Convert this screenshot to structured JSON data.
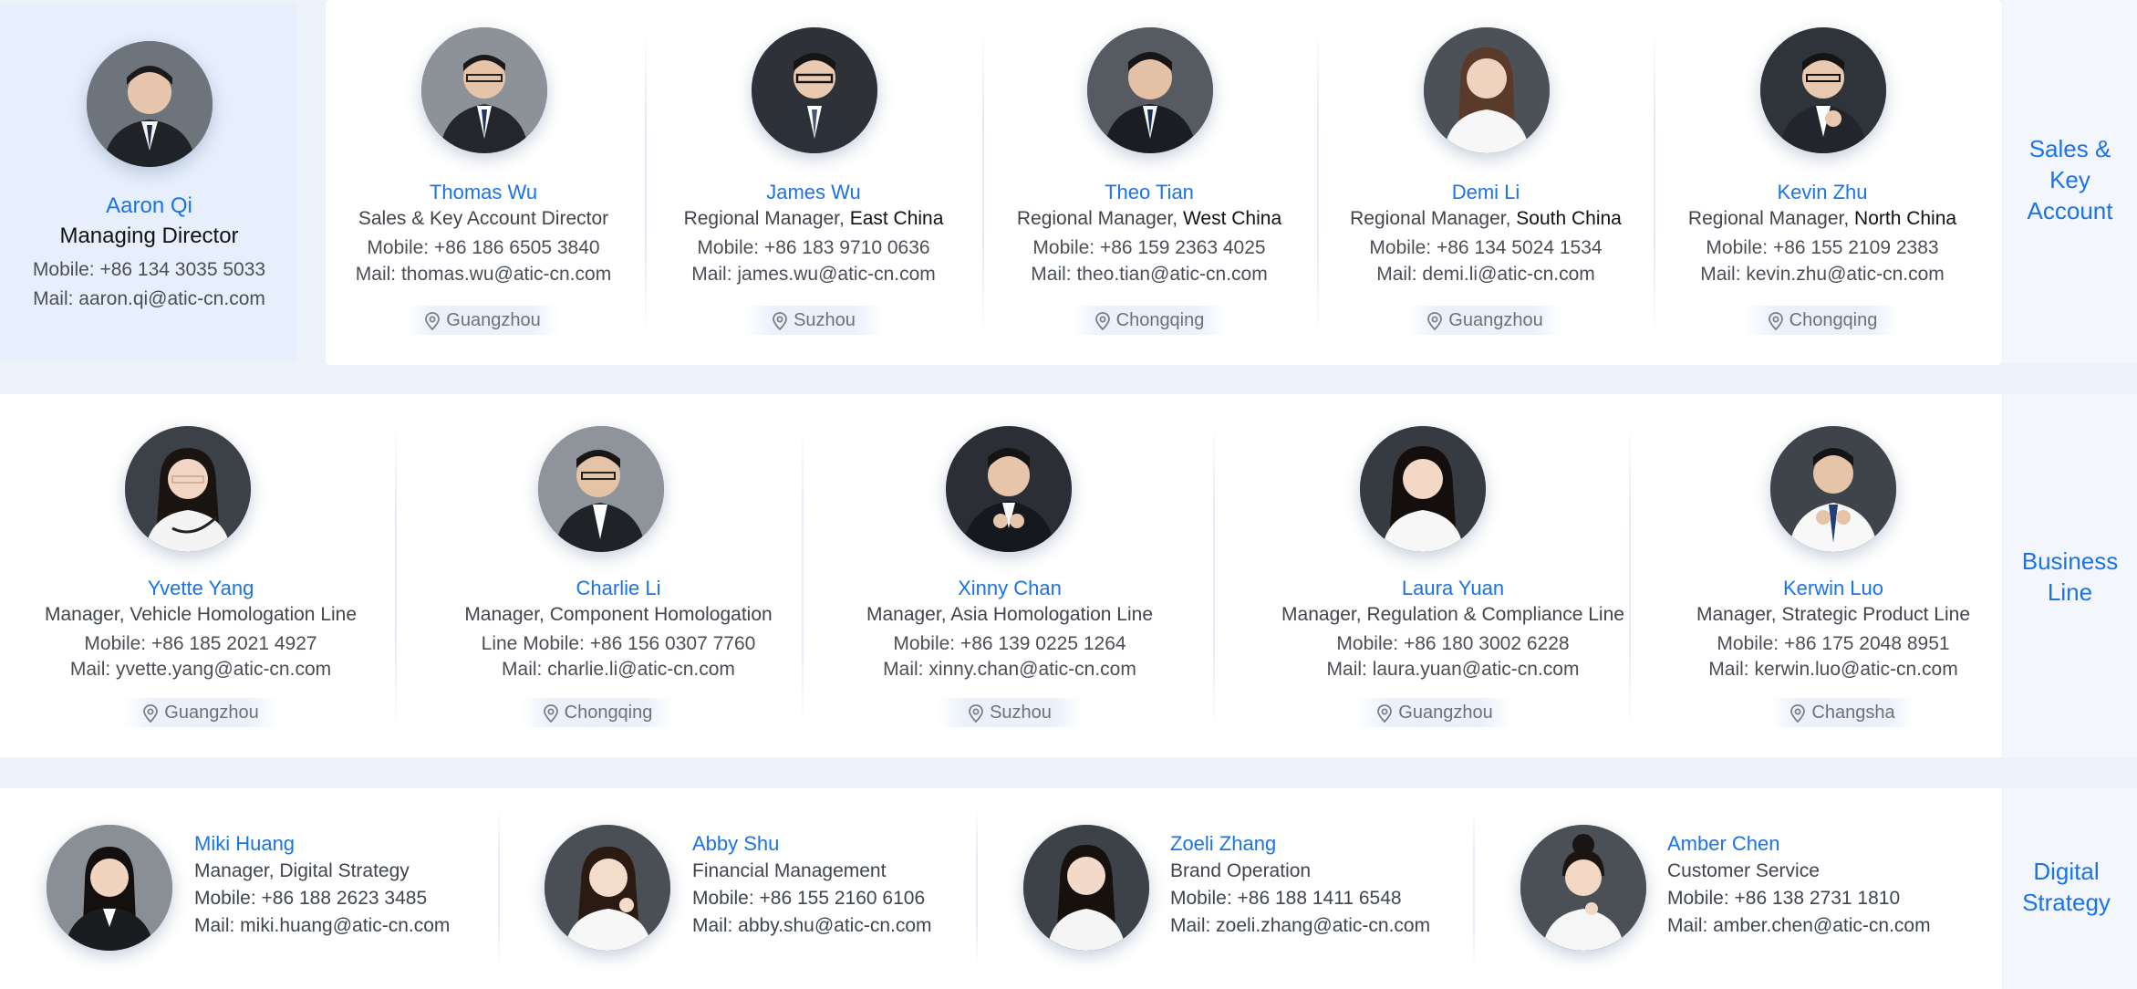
{
  "managing_director": {
    "name": "Aaron Qi",
    "title": "Managing Director",
    "mobile": "Mobile: +86 134 3035 5033",
    "mail": "Mail: aaron.qi@atic-cn.com"
  },
  "sections": {
    "sales": {
      "label_lines": [
        "Sales &",
        "Key",
        "Account"
      ]
    },
    "business": {
      "label_lines": [
        "Business",
        "Line"
      ]
    },
    "digital": {
      "label_lines": [
        "Digital",
        "Strategy"
      ]
    }
  },
  "sales_team": [
    {
      "name": "Thomas Wu",
      "role": "Sales & Key Account Director",
      "role_region": "",
      "mobile": "Mobile: +86 186 6505 3840",
      "mail": "Mail: thomas.wu@atic-cn.com",
      "location": "Guangzhou"
    },
    {
      "name": "James Wu",
      "role": "Regional Manager, ",
      "role_region": "East China",
      "mobile": "Mobile: +86 183 9710 0636",
      "mail": "Mail: james.wu@atic-cn.com",
      "location": "Suzhou"
    },
    {
      "name": "Theo Tian",
      "role": "Regional Manager, ",
      "role_region": "West China",
      "mobile": "Mobile: +86 159 2363 4025",
      "mail": "Mail: theo.tian@atic-cn.com",
      "location": "Chongqing"
    },
    {
      "name": "Demi Li",
      "role": "Regional Manager, ",
      "role_region": "South China",
      "mobile": "Mobile: +86 134 5024 1534",
      "mail": "Mail: demi.li@atic-cn.com",
      "location": "Guangzhou"
    },
    {
      "name": "Kevin Zhu",
      "role": "Regional Manager, ",
      "role_region": "North China",
      "mobile": "Mobile: +86 155 2109 2383",
      "mail": "Mail: kevin.zhu@atic-cn.com",
      "location": "Chongqing"
    }
  ],
  "business_team": [
    {
      "name": "Yvette Yang",
      "role": "Manager, Vehicle Homologation Line",
      "mobile": "Mobile: +86 185 2021 4927",
      "mail": "Mail: yvette.yang@atic-cn.com",
      "location": "Guangzhou"
    },
    {
      "name": "Charlie Li",
      "role": "Manager, Component Homologation",
      "mobile": "Line Mobile: +86 156 0307 7760",
      "mail": "Mail: charlie.li@atic-cn.com",
      "location": "Chongqing"
    },
    {
      "name": "Xinny Chan",
      "role": "Manager, Asia Homologation Line",
      "mobile": "Mobile: +86 139 0225 1264",
      "mail": "Mail: xinny.chan@atic-cn.com",
      "location": "Suzhou"
    },
    {
      "name": "Laura Yuan",
      "role": "Manager, Regulation & Compliance Line",
      "mobile": "Mobile: +86 180 3002 6228",
      "mail": "Mail: laura.yuan@atic-cn.com",
      "location": "Guangzhou"
    },
    {
      "name": "Kerwin Luo",
      "role": "Manager, Strategic Product Line",
      "mobile": "Mobile: +86 175 2048 8951",
      "mail": "Mail: kerwin.luo@atic-cn.com",
      "location": "Changsha"
    }
  ],
  "digital_team": [
    {
      "name": "Miki Huang",
      "role": "Manager, Digital Strategy",
      "mobile": "Mobile: +86 188 2623 3485",
      "mail": "Mail: miki.huang@atic-cn.com"
    },
    {
      "name": "Abby Shu",
      "role": "Financial Management",
      "mobile": "Mobile: +86 155 2160 6106",
      "mail": "Mail: abby.shu@atic-cn.com"
    },
    {
      "name": "Zoeli Zhang",
      "role": "Brand Operation",
      "mobile": "Mobile: +86 188 1411 6548",
      "mail": "Mail: zoeli.zhang@atic-cn.com"
    },
    {
      "name": "Amber Chen",
      "role": "Customer Service",
      "mobile": "Mobile: +86 138 2731 1810",
      "mail": "Mail: amber.chen@atic-cn.com"
    }
  ],
  "colors": {
    "accent": "#1a73e8",
    "background": "#edf3fb",
    "card": "#ffffff",
    "md_card": "#e7effc"
  }
}
